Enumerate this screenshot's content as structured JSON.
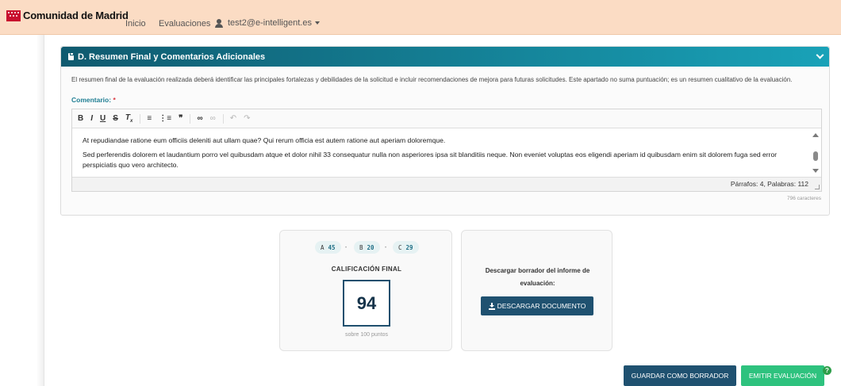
{
  "nav": {
    "brand": "Comunidad de Madrid",
    "links": [
      "Inicio",
      "Evaluaciones"
    ],
    "user": "test2@e-intelligent.es"
  },
  "section": {
    "title": "D. Resumen Final y Comentarios Adicionales",
    "description": "El resumen final de la evaluación realizada deberá identificar las principales fortalezas y debilidades de la solicitud e incluir recomendaciones de mejora para futuras solicitudes. Este apartado no suma puntuación; es un resumen cualitativo de la evaluación.",
    "comment_label": "Comentario:",
    "required_marker": "*",
    "toolbar": [
      "B",
      "I",
      "U",
      "S",
      "Tx",
      "list-ordered",
      "list-unordered",
      "quote",
      "link",
      "unlink",
      "undo",
      "redo"
    ],
    "paragraphs": [
      "At repudiandae ratione eum officiis deleniti aut ullam quae? Qui rerum officia est autem ratione aut aperiam doloremque.",
      "Sed perferendis dolorem et laudantium porro vel quibusdam atque et dolor nihil 33 consequatur nulla non asperiores ipsa sit blanditiis neque. Non eveniet voluptas eos eligendi aperiam id quibusdam enim sit dolorem fuga sed error perspiciatis quo vero architecto."
    ],
    "status": "Párrafos: 4, Palabras: 112",
    "char_count": "796 caracteres"
  },
  "score": {
    "pills": [
      {
        "label": "A",
        "value": "45"
      },
      {
        "label": "B",
        "value": "20"
      },
      {
        "label": "C",
        "value": "29"
      }
    ],
    "title": "CALIFICACIÓN FINAL",
    "value": "94",
    "subtitle": "sobre 100 puntos"
  },
  "download": {
    "text": "Descargar borrador del informe de evaluación:",
    "button": "DESCARGAR DOCUMENTO"
  },
  "actions": {
    "save_draft": "GUARDAR COMO BORRADOR",
    "emit": "EMITIR EVALUACIÓN",
    "help": "?"
  },
  "colors": {
    "nav_bg": "#fbdcc4",
    "header_gradient_start": "#0f5a6f",
    "header_gradient_end": "#19a2b8",
    "primary_button": "#1f5170",
    "success_button": "#2ec27e"
  }
}
